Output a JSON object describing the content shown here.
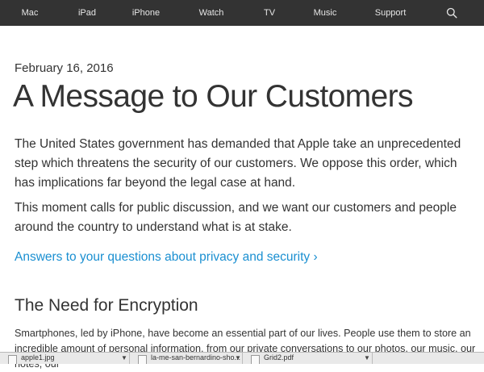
{
  "nav": {
    "items": [
      "Mac",
      "iPad",
      "iPhone",
      "Watch",
      "TV",
      "Music",
      "Support"
    ],
    "search_icon": "search-icon"
  },
  "article": {
    "date": "February 16, 2016",
    "title": "A Message to Our Customers",
    "paragraph1": "The United States government has demanded that Apple take an unprecedented step which threatens the security of our customers. We oppose this order, which has implications far beyond the legal case at hand.",
    "paragraph2": "This moment calls for public discussion, and we want our customers and people around the country to understand what is at stake.",
    "link": "Answers to your questions about privacy and security ›",
    "section_heading": "The Need for Encryption",
    "section_body": "Smartphones, led by iPhone, have become an essential part of our lives. People use them to store an incredible amount of personal information, from our private conversations to our photos, our music, our notes, our"
  },
  "downloads": [
    {
      "name": "apple1.jpg"
    },
    {
      "name": "la-me-san-bernardino-sho..."
    },
    {
      "name": "Grid2.pdf"
    }
  ],
  "colors": {
    "nav_bg": "#333333",
    "nav_text": "#e6e6e6",
    "text": "#333333",
    "link": "#1a8fd1"
  }
}
